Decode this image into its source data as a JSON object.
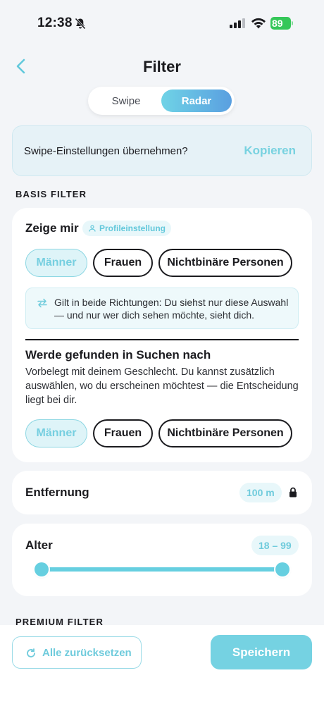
{
  "status_bar": {
    "time": "12:38",
    "battery": "89"
  },
  "header": {
    "title": "Filter"
  },
  "mode_toggle": {
    "options": [
      "Swipe",
      "Radar"
    ],
    "selected": "Radar"
  },
  "copy_banner": {
    "text": "Swipe-Einstellungen übernehmen?",
    "action": "Kopieren"
  },
  "basis_section": {
    "label": "BASIS FILTER",
    "show_me": {
      "label": "Zeige mir",
      "chip": "Profileinstellung",
      "options": [
        "Männer",
        "Frauen",
        "Nichtbinäre Personen"
      ],
      "selected": "Männer",
      "info": "Gilt in beide Richtungen: Du siehst nur diese Auswahl — und nur wer dich sehen möchte, sieht dich."
    },
    "found_in": {
      "title": "Werde gefunden in Suchen nach",
      "description": "Vorbelegt mit deinem Geschlecht. Du kannst zusätzlich auswählen, wo du erscheinen möchtest — die Entscheidung liegt bei dir.",
      "options": [
        "Männer",
        "Frauen",
        "Nichtbinäre Personen"
      ],
      "selected": "Männer"
    }
  },
  "distance": {
    "label": "Entfernung",
    "value": "100 m",
    "icon": "lock-icon"
  },
  "age": {
    "label": "Alter",
    "value": "18 – 99",
    "min": 18,
    "max": 99,
    "range_min": 18,
    "range_max": 99
  },
  "premium_section": {
    "label": "PREMIUM FILTER"
  },
  "footer": {
    "reset_label": "Alle zurücksetzen",
    "save_label": "Speichern"
  },
  "colors": {
    "accent": "#66cfe0",
    "background": "#f3f5f8",
    "battery": "#35c759"
  }
}
